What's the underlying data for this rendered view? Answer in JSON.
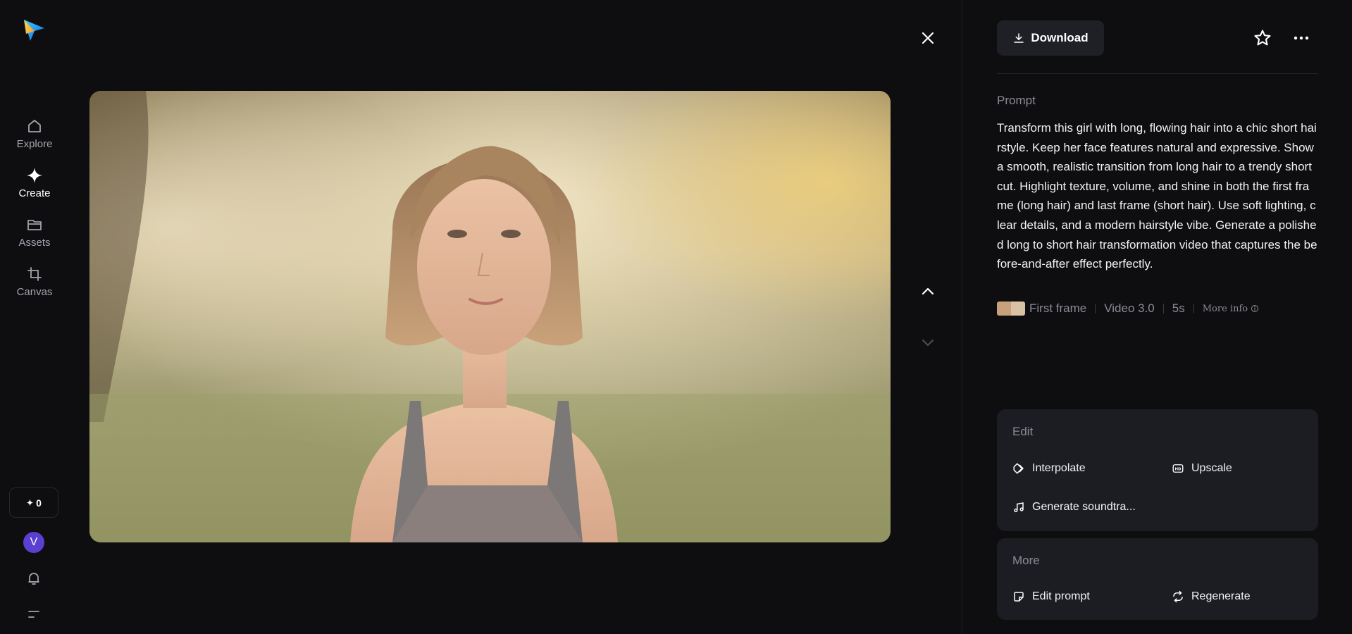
{
  "nav": {
    "items": [
      {
        "label": "Explore",
        "icon": "home-icon"
      },
      {
        "label": "Create",
        "icon": "sparkle-icon"
      },
      {
        "label": "Assets",
        "icon": "folder-icon"
      },
      {
        "label": "Canvas",
        "icon": "crop-icon"
      }
    ],
    "credits": "0",
    "avatar_initial": "V"
  },
  "toolbar": {
    "download_label": "Download"
  },
  "prompt": {
    "label": "Prompt",
    "text": "Transform this girl with long, flowing hair into a chic short hairstyle. Keep her face features natural and expressive. Show a smooth, realistic transition from long hair to a trendy short cut. Highlight texture, volume, and shine in both the first frame (long hair) and last frame (short hair). Use soft lighting, clear details, and a modern hairstyle vibe. Generate a polished long to short hair transformation video that captures the before-and-after effect perfectly."
  },
  "meta": {
    "frame_label": "First frame",
    "model": "Video 3.0",
    "duration": "5s",
    "more_info": "More info"
  },
  "edit_card": {
    "title": "Edit",
    "actions": [
      {
        "label": "Interpolate",
        "icon": "interpolate-icon"
      },
      {
        "label": "Upscale",
        "icon": "hd-icon"
      },
      {
        "label": "Generate soundtra...",
        "icon": "music-note-icon"
      }
    ]
  },
  "more_card": {
    "title": "More",
    "actions": [
      {
        "label": "Edit prompt",
        "icon": "edit-prompt-icon"
      },
      {
        "label": "Regenerate",
        "icon": "regenerate-icon"
      }
    ]
  },
  "colors": {
    "background": "#0e0e11",
    "card": "#1c1d22",
    "button": "#1f2026",
    "muted_text": "#8b8b95",
    "avatar": "#5b3fd0"
  }
}
